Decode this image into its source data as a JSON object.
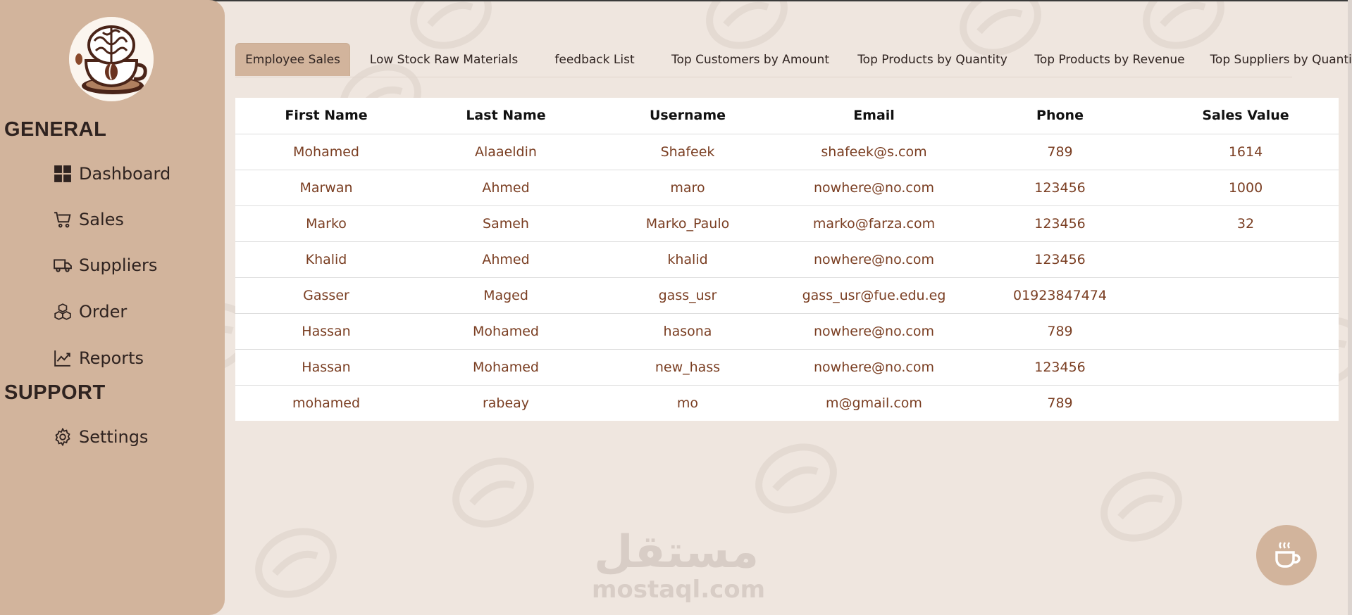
{
  "sidebar": {
    "logo_icon": "coffee-brain-logo",
    "sections": [
      {
        "heading": "GENERAL",
        "items": [
          {
            "label": "Dashboard",
            "icon": "grid-icon"
          },
          {
            "label": "Sales",
            "icon": "cart-icon"
          },
          {
            "label": "Suppliers",
            "icon": "truck-icon"
          },
          {
            "label": "Order",
            "icon": "boxes-icon"
          },
          {
            "label": "Reports",
            "icon": "chart-line-icon"
          }
        ]
      },
      {
        "heading": "SUPPORT",
        "items": [
          {
            "label": "Settings",
            "icon": "gear-icon"
          }
        ]
      }
    ]
  },
  "tabs": [
    {
      "label": "Employee Sales",
      "active": true
    },
    {
      "label": "Low Stock Raw Materials",
      "active": false
    },
    {
      "label": "feedback List",
      "active": false
    },
    {
      "label": "Top Customers by Amount",
      "active": false
    },
    {
      "label": "Top Products by Quantity",
      "active": false
    },
    {
      "label": "Top Products by Revenue",
      "active": false
    },
    {
      "label": "Top Suppliers by Quantity",
      "active": false
    }
  ],
  "table": {
    "columns": [
      "First Name",
      "Last Name",
      "Username",
      "Email",
      "Phone",
      "Sales Value"
    ],
    "rows": [
      [
        "Mohamed",
        "Alaaeldin",
        "Shafeek",
        "shafeek@s.com",
        "789",
        "1614"
      ],
      [
        "Marwan",
        "Ahmed",
        "maro",
        "nowhere@no.com",
        "123456",
        "1000"
      ],
      [
        "Marko",
        "Sameh",
        "Marko_Paulo",
        "marko@farza.com",
        "123456",
        "32"
      ],
      [
        "Khalid",
        "Ahmed",
        "khalid",
        "nowhere@no.com",
        "123456",
        ""
      ],
      [
        "Gasser",
        "Maged",
        "gass_usr",
        "gass_usr@fue.edu.eg",
        "01923847474",
        ""
      ],
      [
        "Hassan",
        "Mohamed",
        "hasona",
        "nowhere@no.com",
        "789",
        ""
      ],
      [
        "Hassan",
        "Mohamed",
        "new_hass",
        "nowhere@no.com",
        "123456",
        ""
      ],
      [
        "mohamed",
        "rabeay",
        "mo",
        "m@gmail.com",
        "789",
        ""
      ]
    ]
  },
  "watermark": {
    "arabic": "مستقل",
    "latin": "mostaql.com"
  },
  "fab": {
    "icon": "coffee-cup-icon"
  },
  "colors": {
    "sidebar": "#d2b49c",
    "background": "#efe6df",
    "cell_text": "#7a3e22",
    "header_text": "#111111"
  }
}
